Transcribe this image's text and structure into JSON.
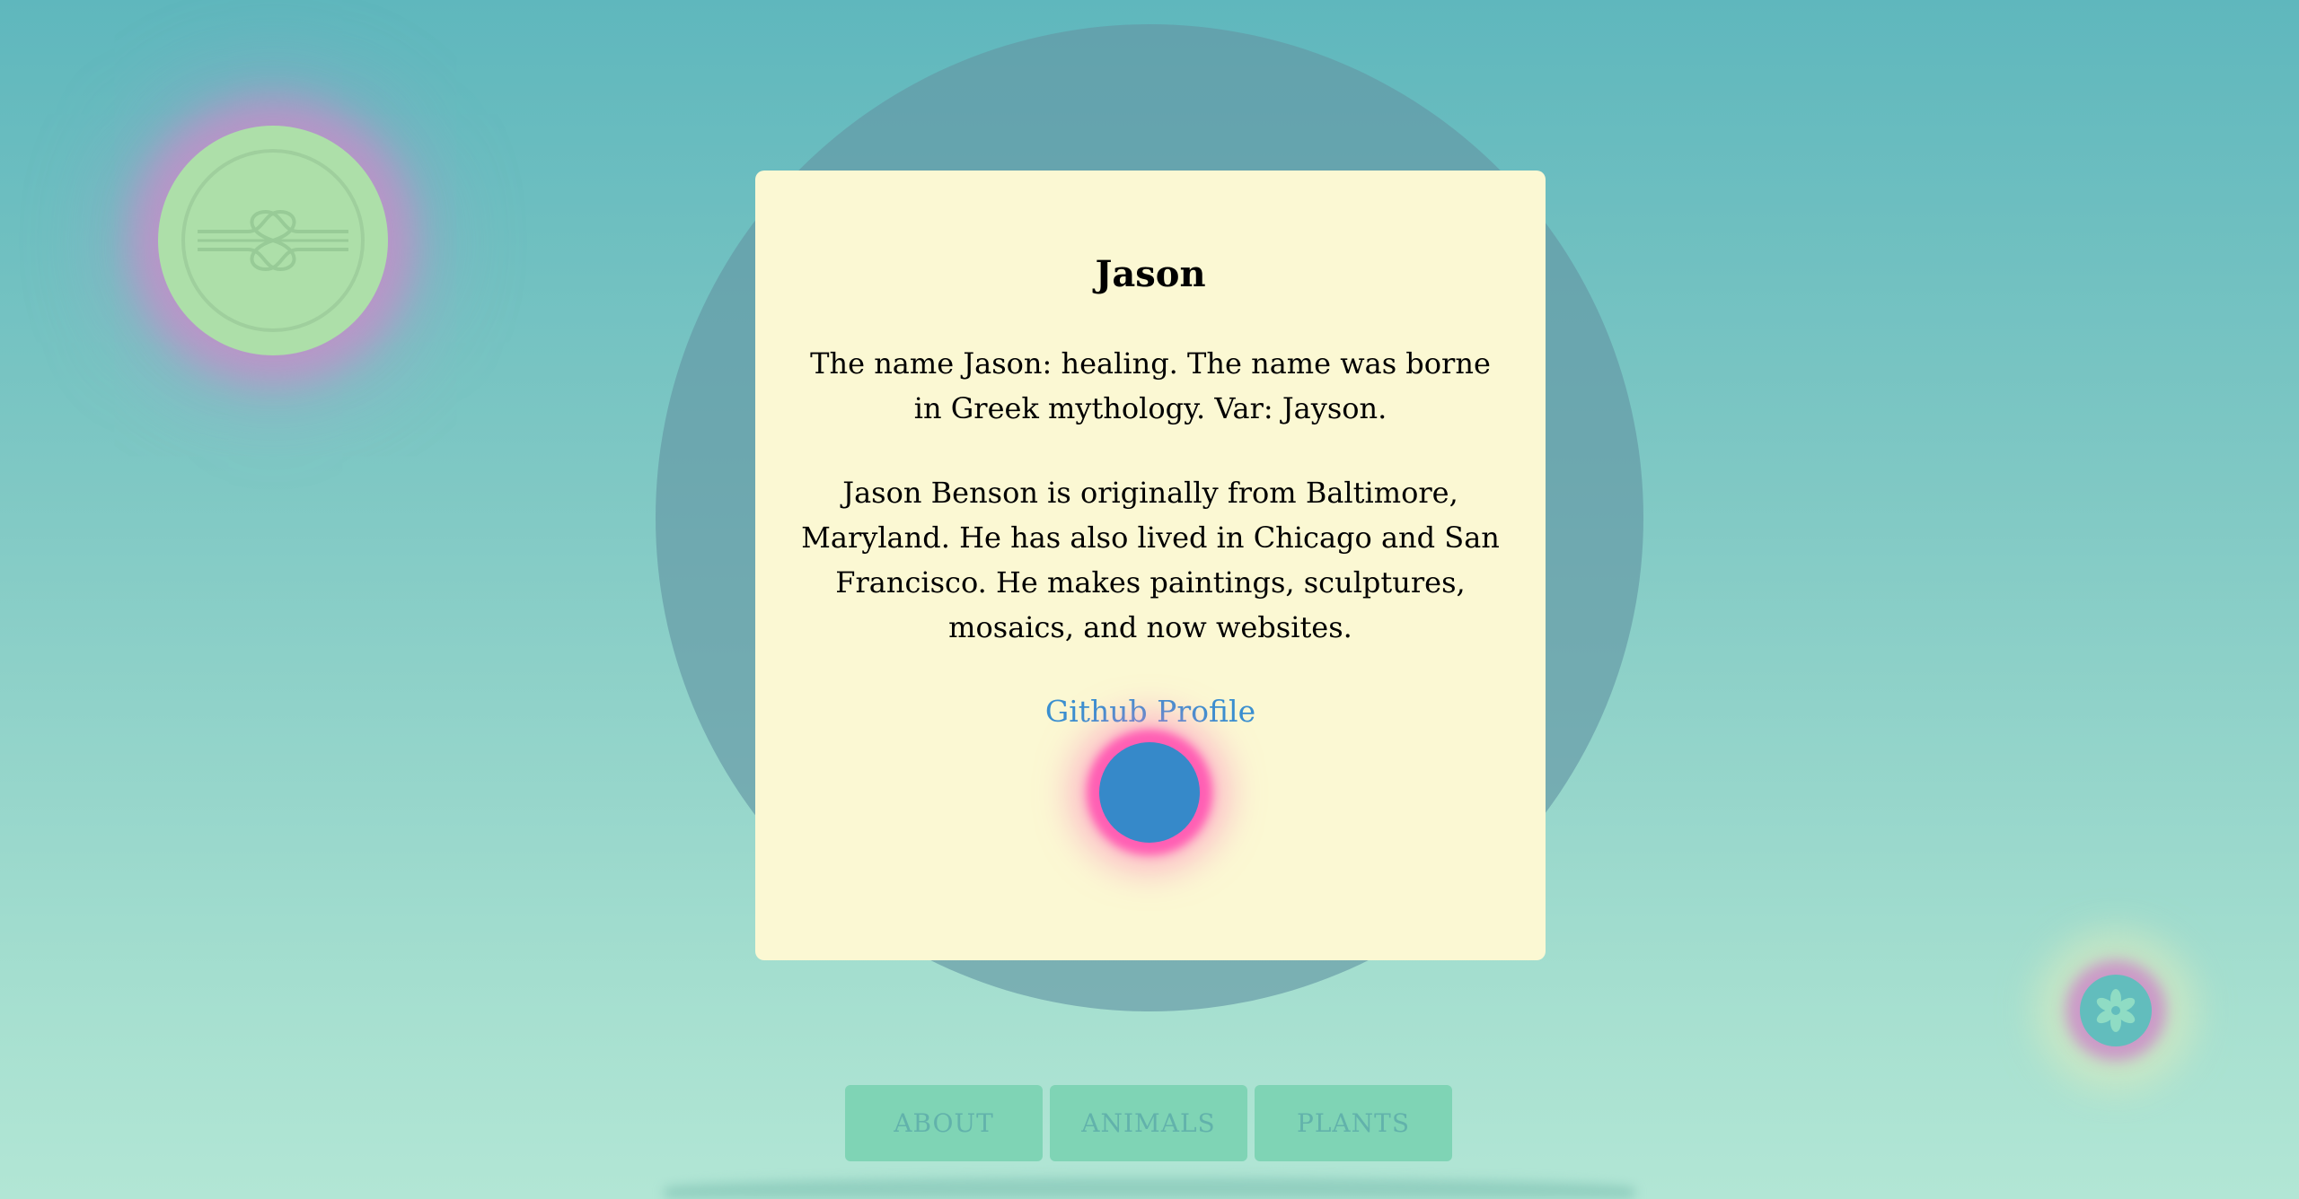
{
  "profile": {
    "name": "Jason",
    "meaning": "The name Jason: healing. The name was borne in Greek mythology. Var: Jayson.",
    "bio": "Jason Benson is originally from Baltimore, Maryland. He has also lived in Chicago and San Francisco. He makes paintings, sculptures, mosaics, and now websites.",
    "link_label": "Github Profile"
  },
  "nav": {
    "items": [
      {
        "label": "ABOUT"
      },
      {
        "label": "ANIMALS"
      },
      {
        "label": "PLANTS"
      }
    ]
  },
  "icons": {
    "top_left": "knot-icon",
    "bottom_right": "flower-icon",
    "card_orb": "orb-icon"
  },
  "colors": {
    "card_background": "#fbf8d3",
    "link": "#3a8fd0",
    "orb": "#3689c9",
    "orb_glow": "#ff5fb4",
    "nav_button": "#7fd4b5",
    "logo_circle": "#addfa9"
  }
}
